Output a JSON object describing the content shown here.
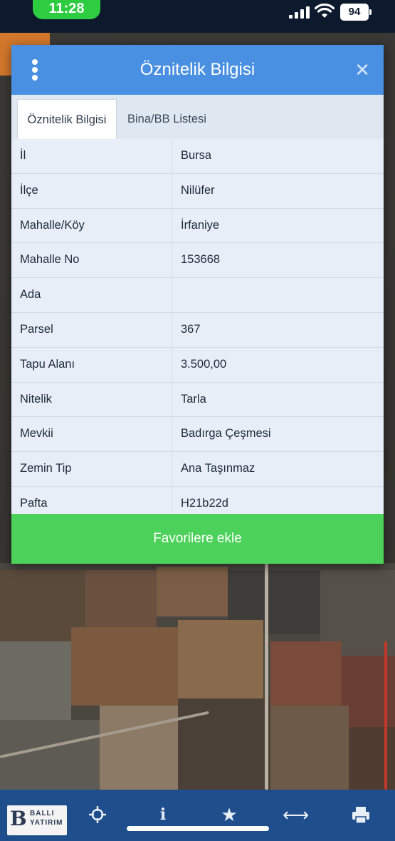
{
  "status_bar": {
    "time": "11:28",
    "battery": "94"
  },
  "modal": {
    "title": "Öznitelik Bilgisi",
    "tabs": [
      {
        "label": "Öznitelik Bilgisi",
        "active": true
      },
      {
        "label": "Bina/BB Listesi",
        "active": false
      }
    ],
    "rows": [
      {
        "key": "İl",
        "value": "Bursa"
      },
      {
        "key": "İlçe",
        "value": "Nilüfer"
      },
      {
        "key": "Mahalle/Köy",
        "value": "İrfaniye"
      },
      {
        "key": "Mahalle No",
        "value": "153668"
      },
      {
        "key": "Ada",
        "value": ""
      },
      {
        "key": "Parsel",
        "value": "367"
      },
      {
        "key": "Tapu Alanı",
        "value": "3.500,00"
      },
      {
        "key": "Nitelik",
        "value": "Tarla"
      },
      {
        "key": "Mevkii",
        "value": "Badırga Çeşmesi"
      },
      {
        "key": "Zemin Tip",
        "value": "Ana Taşınmaz"
      },
      {
        "key": "Pafta",
        "value": "H21b22d"
      }
    ],
    "favorite_button": "Favorilere ekle"
  },
  "toolbar": {
    "logo": {
      "letter": "B",
      "line1": "BALLI",
      "line2": "YATIRIM"
    },
    "icons": [
      "crosshair-icon",
      "info-icon",
      "star-icon",
      "measure-icon",
      "print-icon"
    ]
  },
  "colors": {
    "header": "#4a90e2",
    "favorite": "#4cd25a",
    "toolbar": "#1f4e8c",
    "status_pill": "#2ecc40"
  }
}
